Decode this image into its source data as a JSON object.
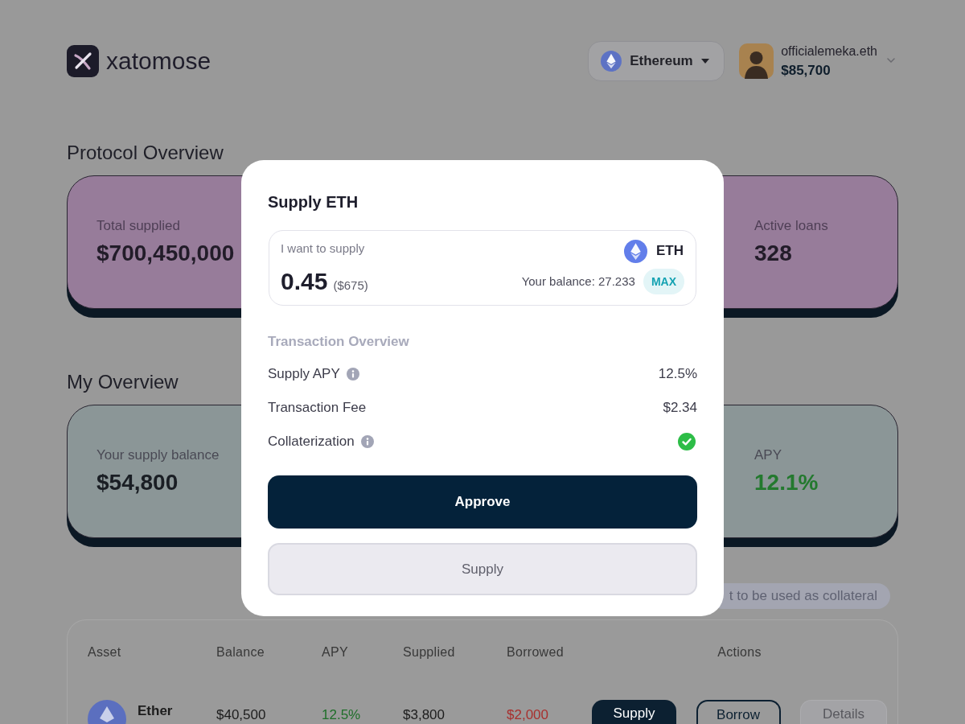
{
  "brand": {
    "name": "xatomose"
  },
  "header": {
    "network": "Ethereum",
    "account": {
      "name": "officialemeka.eth",
      "balance": "$85,700"
    }
  },
  "sections": [
    {
      "title": "Protocol Overview",
      "color": "#977c9a",
      "stats": [
        {
          "label": "Total supplied",
          "value": "$700,450,000",
          "color": "#221c29"
        },
        {
          "label": "Active loans",
          "value": "328",
          "color": "#221c29"
        }
      ]
    },
    {
      "title": "My Overview",
      "color": "#8b9697",
      "stats": [
        {
          "label": "Your supply balance",
          "value": "$54,800",
          "color": "#1a1e24"
        },
        {
          "label": "APY",
          "value": "12.1%",
          "color": "#23792e"
        }
      ]
    }
  ],
  "collateral_hint": "t to be used as collateral",
  "table": {
    "columns": [
      "Asset",
      "Balance",
      "APY",
      "Supplied",
      "Borrowed",
      "Actions"
    ],
    "rows": [
      {
        "asset": "Ether",
        "values": [
          {
            "text": "$40,500",
            "color": "#1c1c1c"
          },
          {
            "text": "12.5%",
            "color": "#1f6e29"
          },
          {
            "text": "$3,800",
            "color": "#1c1c1c"
          },
          {
            "text": "$2,000",
            "color": "#a8302e"
          }
        ],
        "actions": [
          {
            "label": "Supply",
            "kind": "filled",
            "disabled": false
          },
          {
            "label": "Borrow",
            "kind": "outline",
            "disabled": false
          },
          {
            "label": "Details",
            "kind": "filled",
            "disabled": true
          }
        ]
      }
    ]
  },
  "modal": {
    "title": "Supply ETH",
    "input": {
      "label": "I want to supply",
      "value": "0.45",
      "fiat": "($675)",
      "token": "ETH",
      "balance": "Your balance: 27.233",
      "max": "MAX"
    },
    "overview_title": "Transaction Overview",
    "rows": [
      {
        "label": "Supply APY",
        "info": true,
        "kind": "text",
        "value": "12.5%"
      },
      {
        "label": "Transaction Fee",
        "info": false,
        "kind": "text",
        "value": "$2.34"
      },
      {
        "label": "Collaterization",
        "info": true,
        "kind": "check",
        "checked": true
      }
    ],
    "buttons": [
      {
        "label": "Approve",
        "disabled": false
      },
      {
        "label": "Supply",
        "disabled": true
      }
    ]
  }
}
